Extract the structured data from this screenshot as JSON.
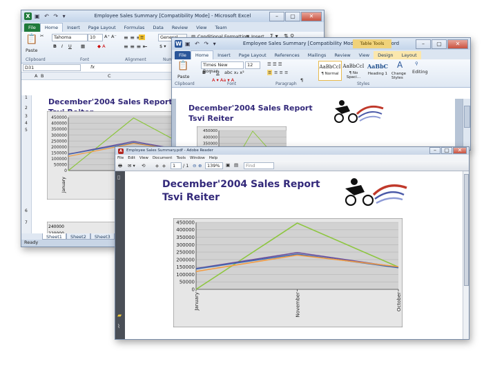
{
  "colors": {
    "excel_green": "#1f7a3b",
    "word_blue": "#2a5699",
    "report_title": "#33297a",
    "series_green": "#8dc63f",
    "series_purple": "#6a4c9c",
    "series_orange": "#f39c42",
    "series_blue": "#4169b0"
  },
  "excel": {
    "title": "Employee Sales Summary  [Compatibility Mode] - Microsoft Excel",
    "file_tab": "File",
    "tabs": [
      "Home",
      "Insert",
      "Page Layout",
      "Formulas",
      "Data",
      "Review",
      "View",
      "Team"
    ],
    "font_name": "Tahoma",
    "font_size": "10",
    "number_format": "General",
    "conditional_formatting": "Conditional Formatting",
    "insert_label": "Insert",
    "group_clipboard": "Clipboard",
    "group_font": "Font",
    "group_alignment": "Alignment",
    "group_number": "Numb",
    "paste_label": "Paste",
    "name_box": "D31",
    "fx": "fx",
    "col_headers": [
      "A",
      "B",
      "C"
    ],
    "row_numbers": [
      "1",
      "2",
      "3",
      "4",
      "5",
      "6",
      "7"
    ],
    "report_title_line1": "December'2004 Sales Report",
    "report_title_line2": "Tsvi Reiter",
    "chart_y_ticks": [
      "450000",
      "400000",
      "350000",
      "300000",
      "250000",
      "200000",
      "150000",
      "100000",
      "50000",
      "0"
    ],
    "chart_x_first": "January",
    "chart2_y_ticks": [
      "240000",
      "220000"
    ],
    "sheet_tabs": [
      "Sheet1",
      "Sheet2",
      "Sheet3"
    ],
    "status": "Ready"
  },
  "word": {
    "title": "Employee Sales Summary [Compatibility Mode] - Microsoft Word",
    "table_tools": "Table Tools",
    "file_tab": "File",
    "tabs": [
      "Home",
      "Insert",
      "Page Layout",
      "References",
      "Mailings",
      "Review",
      "View",
      "Design",
      "Layout"
    ],
    "font_name": "Times New Roman",
    "font_size": "12",
    "group_clipboard": "Clipboard",
    "group_font": "Font",
    "group_paragraph": "Paragraph",
    "group_styles": "Styles",
    "paste_label": "Paste",
    "styles": [
      {
        "sample": "AaBbCcI",
        "name": "¶ Normal"
      },
      {
        "sample": "AaBbCcI",
        "name": "¶ No Spaci..."
      },
      {
        "sample": "AaBbC",
        "name": "Heading 1"
      }
    ],
    "change_styles": "Change Styles",
    "editing": "Editing",
    "report_title_line1": "December'2004 Sales Report",
    "report_title_line2": "Tsvi Reiter",
    "chart_y_ticks": [
      "450000",
      "400000",
      "350000",
      "300000",
      "250000"
    ]
  },
  "reader": {
    "title": "Employee Sales Summary.pdf - Adobe Reader",
    "menu": [
      "File",
      "Edit",
      "View",
      "Document",
      "Tools",
      "Window",
      "Help"
    ],
    "page_current": "1",
    "page_total": "/ 1",
    "zoom": "139%",
    "find_placeholder": "Find",
    "report_title_line1": "December'2004 Sales Report",
    "report_title_line2": "Tsvi Reiter"
  },
  "chart_data": {
    "type": "line",
    "categories": [
      "January",
      "November",
      "October"
    ],
    "ylim": [
      0,
      450000
    ],
    "yticks": [
      0,
      50000,
      100000,
      150000,
      200000,
      250000,
      300000,
      350000,
      400000,
      450000
    ],
    "series": [
      {
        "color": "#8dc63f",
        "values": [
          0,
          445000,
          150000
        ]
      },
      {
        "color": "#6a4c9c",
        "values": [
          140000,
          247000,
          148000
        ]
      },
      {
        "color": "#4169b0",
        "values": [
          137000,
          237000,
          145000
        ]
      },
      {
        "color": "#f39c42",
        "values": [
          120000,
          230000,
          152000
        ]
      }
    ]
  }
}
